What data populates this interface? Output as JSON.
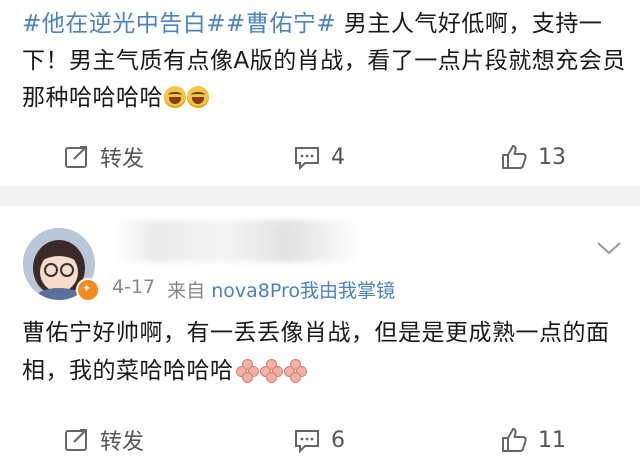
{
  "post": {
    "tag1": "#他在逆光中告白#",
    "tag2": "#曹佑宁#",
    "text": " 男主人气好低啊，支持一下！男主气质有点像A版的肖战，看了一点片段就想充会员那种哈哈哈哈",
    "emoji": [
      "laughing-emoji",
      "laughing-emoji"
    ]
  },
  "post_actions": {
    "repost_label": "转发",
    "comment_count": "4",
    "like_count": "13"
  },
  "comment": {
    "date": "4-17",
    "source_prefix": "来自",
    "source": "nova8Pro我由我掌镜",
    "text": "曹佑宁好帅啊，有一丢丢像肖战，但是是更成熟一点的面相，我的菜哈哈哈哈",
    "emoji": [
      "flower-emoji",
      "flower-emoji",
      "flower-emoji"
    ]
  },
  "comment_actions": {
    "repost_label": "转发",
    "comment_count": "6",
    "like_count": "11"
  },
  "colors": {
    "link": "#4a82c4",
    "divider": "#f2f2f2",
    "badge": "#f28a1c"
  }
}
